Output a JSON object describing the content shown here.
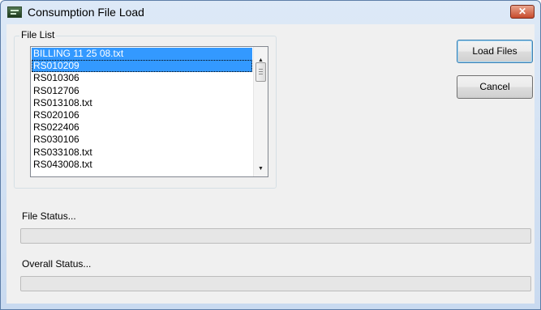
{
  "window": {
    "title": "Consumption File Load",
    "close_glyph": "✕"
  },
  "file_list": {
    "group_label": "File List",
    "items": [
      {
        "label": "BILLING 11 25 08.txt",
        "selected": true
      },
      {
        "label": "RS010209",
        "selected": true
      },
      {
        "label": "RS010306",
        "selected": false
      },
      {
        "label": "RS012706",
        "selected": false
      },
      {
        "label": "RS013108.txt",
        "selected": false
      },
      {
        "label": "RS020106",
        "selected": false
      },
      {
        "label": "RS022406",
        "selected": false
      },
      {
        "label": "RS030106",
        "selected": false
      },
      {
        "label": "RS033108.txt",
        "selected": false
      },
      {
        "label": "RS043008.txt",
        "selected": false
      }
    ]
  },
  "buttons": {
    "load_files": "Load Files",
    "cancel": "Cancel"
  },
  "file_status": {
    "label": "File Status...",
    "progress": 0
  },
  "overall_status": {
    "label": "Overall Status...",
    "progress": 0
  },
  "colors": {
    "selection": "#3399ff",
    "progress_fill": "#06b025"
  },
  "icons": {
    "app": "app-icon",
    "close": "close-icon",
    "scroll_up": "scroll-up-arrow-icon",
    "scroll_down": "scroll-down-arrow-icon"
  }
}
